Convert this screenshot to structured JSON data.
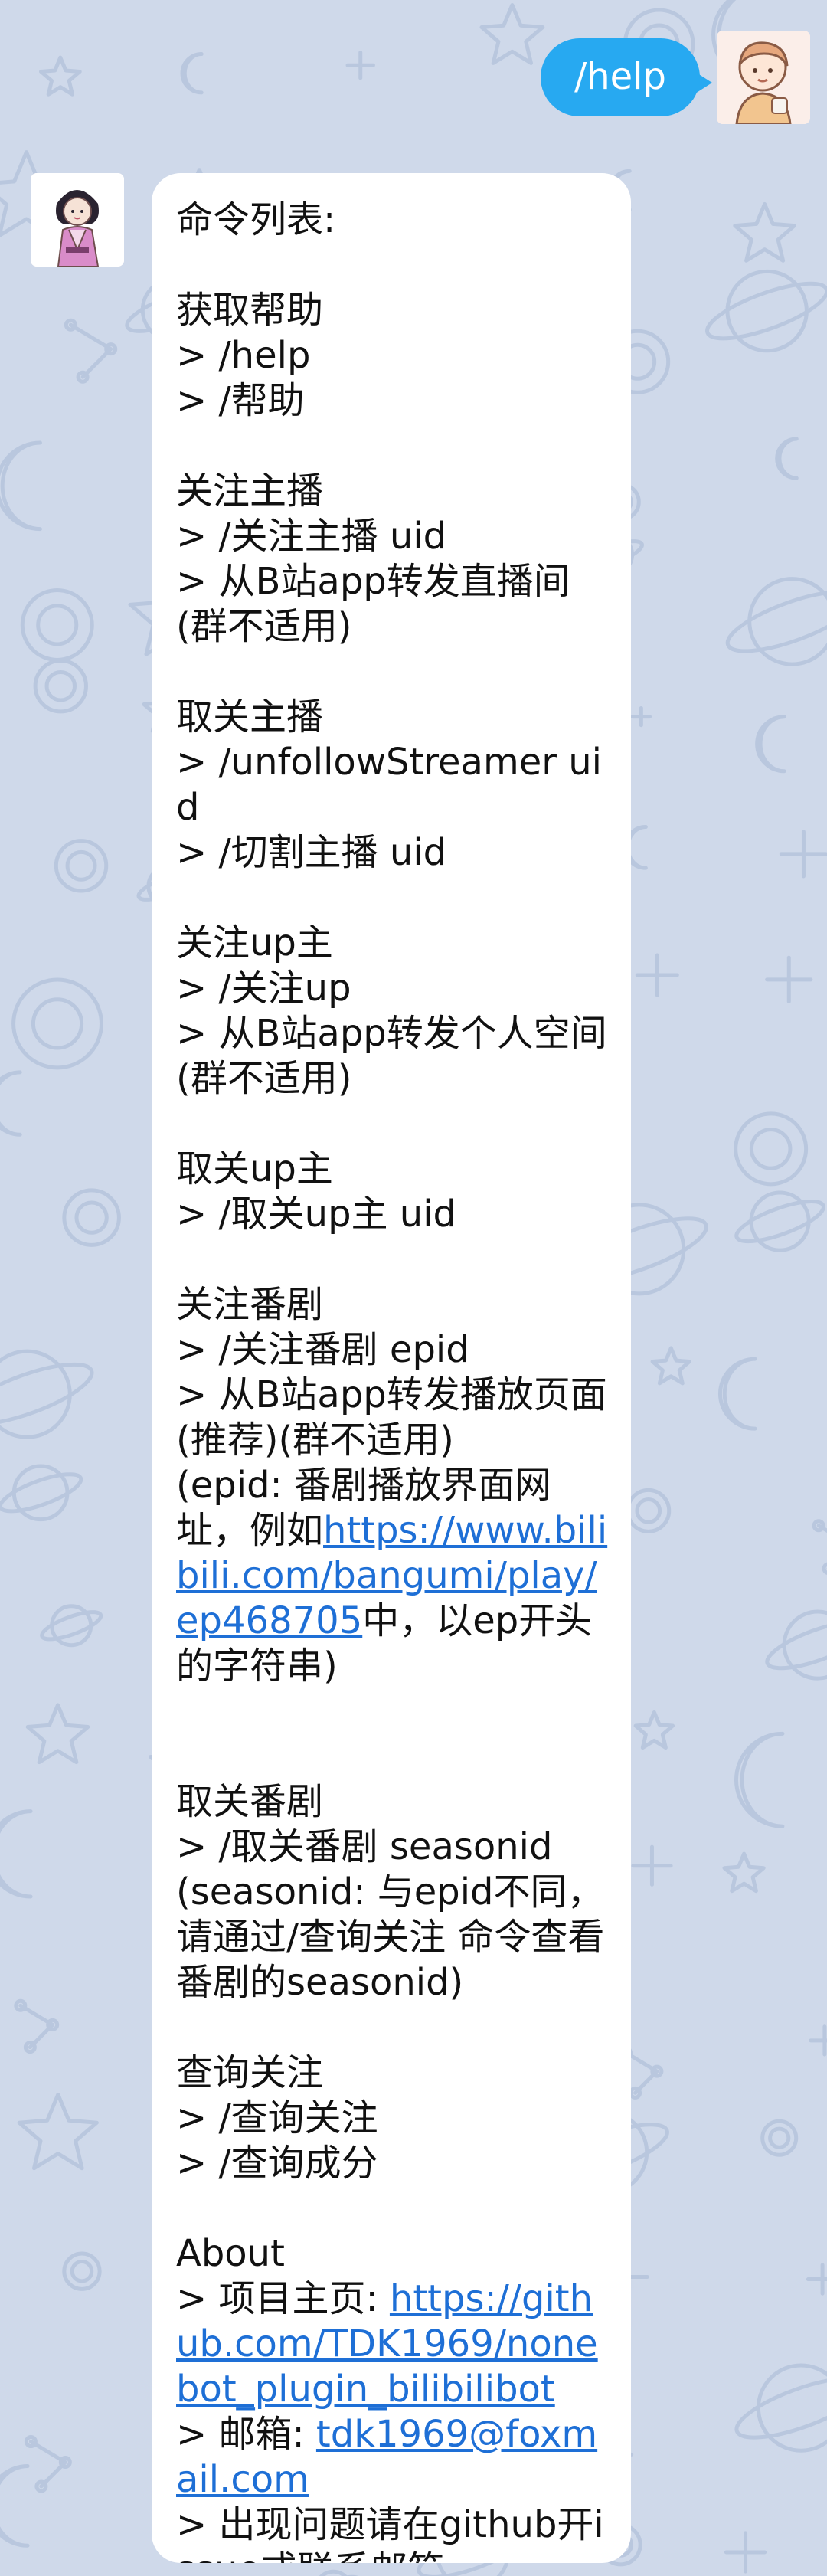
{
  "chat": {
    "outgoing": {
      "text": "/help",
      "sender_avatar": "avatar-user-cartoon-boy"
    },
    "incoming": {
      "sender_avatar": "avatar-bot-kimono-girl",
      "segments": [
        {
          "text": "命令列表:\n\n获取帮助\n> /help\n> /帮助\n\n关注主播\n> /关注主播 uid\n> 从B站app转发直播间(群不适用)\n\n取关主播\n> /unfollowStreamer uid\n> /切割主播 uid\n\n关注up主\n> /关注up\n> 从B站app转发个人空间(群不适用)\n\n取关up主\n> /取关up主 uid\n\n关注番剧\n> /关注番剧 epid\n> 从B站app转发播放页面(推荐)(群不适用)\n(epid: 番剧播放界面网址，例如"
        },
        {
          "text": "https://www.bilibili.com/bangumi/play/ep468705",
          "link": true
        },
        {
          "text": "中，以ep开头的字符串)\n\n\n取关番剧\n> /取关番剧 seasonid\n(seasonid: 与epid不同，请通过/查询关注 命令查看番剧的seasonid)\n\n查询关注\n> /查询关注\n> /查询成分\n\nAbout\n> 项目主页: "
        },
        {
          "text": "https://github.com/TDK1969/nonebot_plugin_bilibilibot",
          "link": true
        },
        {
          "text": "\n> 邮箱: "
        },
        {
          "text": "tdk1969@foxmail.com",
          "link": true
        },
        {
          "text": "\n> 出现问题请在github开issue或联系邮箱"
        }
      ]
    }
  },
  "colors": {
    "wallpaper": "#cfd9ea",
    "outgoing_bubble": "#27a9f1",
    "incoming_bubble": "#ffffff",
    "link": "#1e6fd6"
  }
}
